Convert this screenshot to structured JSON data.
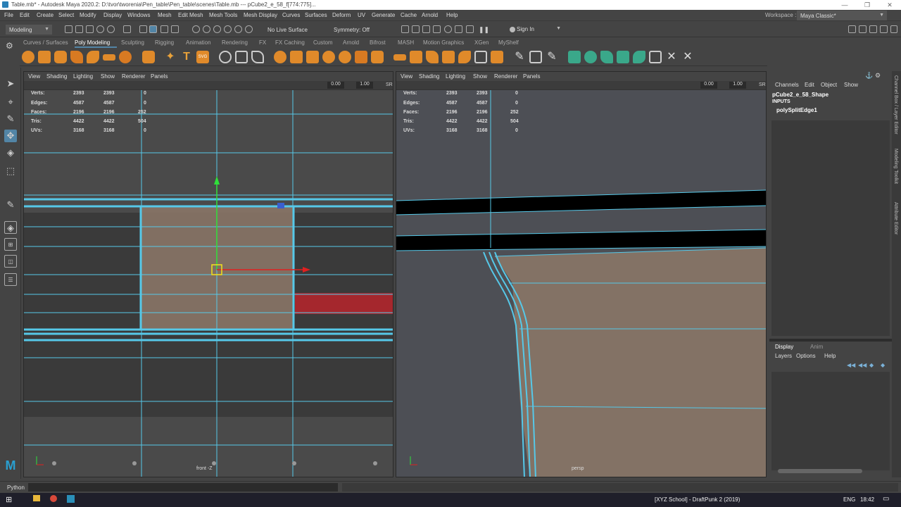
{
  "window": {
    "title": "Table.mb* - Autodesk Maya 2020.2: D:\\tvor\\tworenia\\Pen_table\\Pen_table\\scenes\\Table.mb   ---   pCube2_e_58_f[774:775]..."
  },
  "menu": [
    "File",
    "Edit",
    "Create",
    "Select",
    "Modify",
    "Display",
    "Windows",
    "Mesh",
    "Edit Mesh",
    "Mesh Tools",
    "Mesh Display",
    "Curves",
    "Surfaces",
    "Deform",
    "UV",
    "Generate",
    "Cache",
    "Arnold",
    "Help"
  ],
  "workspace": {
    "label": "Workspace :",
    "value": "Maya Classic*"
  },
  "status_line": {
    "mode": "Modeling",
    "live_surface": "No Live Surface",
    "symmetry": "Symmetry: Off",
    "sign_in": "Sign In"
  },
  "shelf_tabs": [
    "Curves / Surfaces",
    "Poly Modeling",
    "Sculpting",
    "Rigging",
    "Animation",
    "Rendering",
    "FX",
    "FX Caching",
    "Custom",
    "Arnold",
    "Bifrost",
    "MASH",
    "Motion Graphics",
    "XGen",
    "MyShelf"
  ],
  "shelf_active": "Poly Modeling",
  "viewport_menu": [
    "View",
    "Shading",
    "Lighting",
    "Show",
    "Renderer",
    "Panels"
  ],
  "hud": {
    "rows": [
      {
        "label": "Verts:",
        "v1": "2393",
        "v2": "2393",
        "v3": "0"
      },
      {
        "label": "Edges:",
        "v1": "4587",
        "v2": "4587",
        "v3": "0"
      },
      {
        "label": "Faces:",
        "v1": "2196",
        "v2": "2196",
        "v3": "252"
      },
      {
        "label": "Tris:",
        "v1": "4422",
        "v2": "4422",
        "v3": "504"
      },
      {
        "label": "UVs:",
        "v1": "3168",
        "v2": "3168",
        "v3": "0"
      }
    ]
  },
  "viewport_fields": {
    "val1": "0.00",
    "val2": "1.00"
  },
  "viewport_left": {
    "camera": "front -Z"
  },
  "viewport_right": {
    "camera": "persp"
  },
  "channel_box": {
    "tabs": [
      "Channels",
      "Edit",
      "Object",
      "Show"
    ],
    "object": "pCube2_e_58_Shape",
    "inputs_label": "INPUTS",
    "input_node": "polySplitEdge1"
  },
  "layer_editor": {
    "tabs": [
      "Display",
      "Anim"
    ],
    "menu": [
      "Layers",
      "Options",
      "Help"
    ]
  },
  "side_tabs": [
    "Channel Box / Layer Editor",
    "Modeling Toolkit",
    "Attribute Editor"
  ],
  "command_line": {
    "label": "Python"
  },
  "taskbar": {
    "task": "[XYZ School] - DraftPunk 2 (2019)",
    "lang": "ENG",
    "time": "18:42"
  },
  "colors": {
    "wire": "#56c8e8",
    "mesh_fill": "#8a7667",
    "selected_face": "#b8252b",
    "y_axis": "#2fe03a",
    "x_axis": "#e02020",
    "accent": "#5285a6"
  }
}
